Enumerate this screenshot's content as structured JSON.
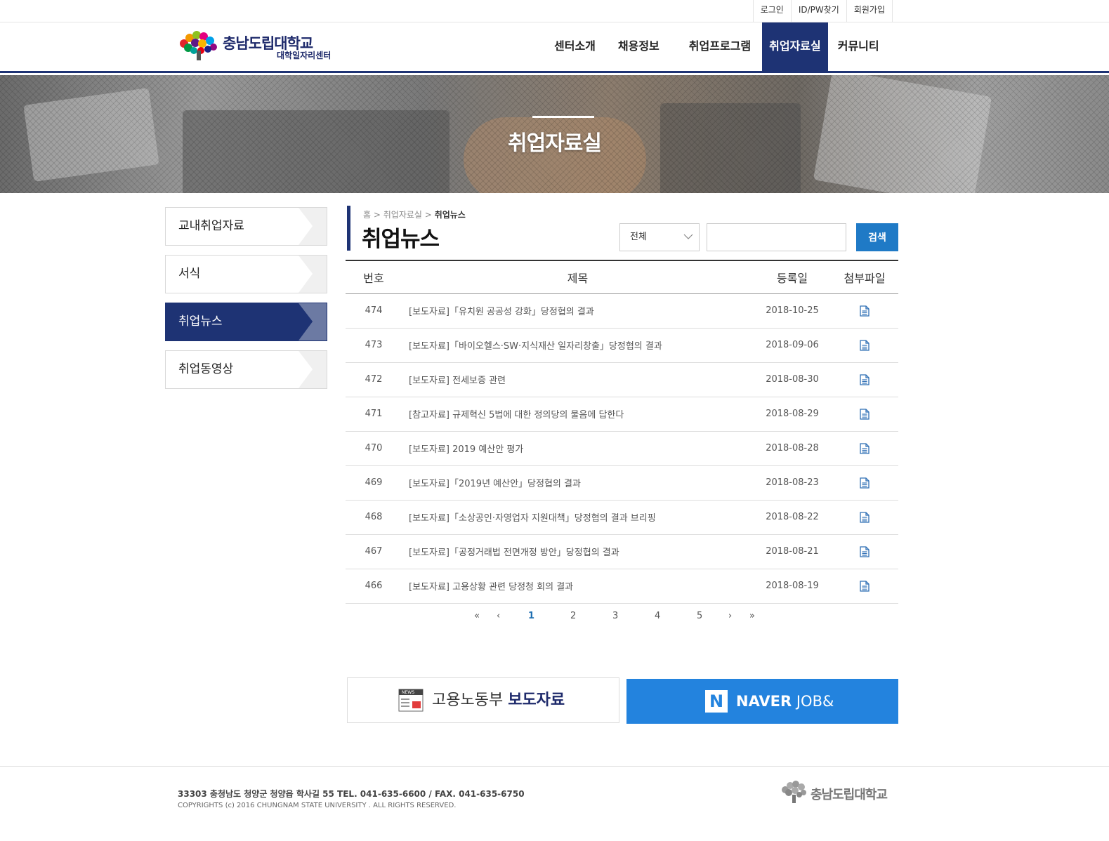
{
  "util_links": [
    "로그인",
    "ID/PW찾기",
    "회원가입"
  ],
  "logo": {
    "title": "충남도립대학교",
    "subtitle": "대학일자리센터"
  },
  "gnb": [
    {
      "label": "센터소개",
      "active": false
    },
    {
      "label": "채용정보",
      "active": false
    },
    {
      "label": "취업프로그램",
      "active": false
    },
    {
      "label": "취업자료실",
      "active": true
    },
    {
      "label": "커뮤니티",
      "active": false
    }
  ],
  "hero": {
    "title": "취업자료실"
  },
  "lnb": [
    {
      "label": "교내취업자료",
      "active": false
    },
    {
      "label": "서식",
      "active": false
    },
    {
      "label": "취업뉴스",
      "active": true
    },
    {
      "label": "취업동영상",
      "active": false
    }
  ],
  "breadcrumb": {
    "home": "홈",
    "sep": ">",
    "parent": "취업자료실",
    "current": "취업뉴스"
  },
  "page_title": "취업뉴스",
  "search": {
    "select_value": "전체",
    "input_value": "",
    "button_label": "검색"
  },
  "board": {
    "headers": {
      "no": "번호",
      "title": "제목",
      "date": "등록일",
      "file": "첨부파일"
    },
    "rows": [
      {
        "no": "474",
        "title": "[보도자료]「유치원 공공성 강화」당정협의 결과",
        "date": "2018-10-25"
      },
      {
        "no": "473",
        "title": "[보도자료]「바이오헬스·SW·지식재산 일자리창출」당정협의 결과",
        "date": "2018-09-06"
      },
      {
        "no": "472",
        "title": "[보도자료] 전세보증 관련",
        "date": "2018-08-30"
      },
      {
        "no": "471",
        "title": "[참고자료] 규제혁신 5법에 대한 정의당의 물음에 답한다",
        "date": "2018-08-29"
      },
      {
        "no": "470",
        "title": "[보도자료] 2019 예산안 평가",
        "date": "2018-08-28"
      },
      {
        "no": "469",
        "title": "[보도자료]「2019년 예산안」당정협의 결과",
        "date": "2018-08-23"
      },
      {
        "no": "468",
        "title": "[보도자료]「소상공인·자영업자 지원대책」당정협의 결과 브리핑",
        "date": "2018-08-22"
      },
      {
        "no": "467",
        "title": "[보도자료]「공정거래법 전면개정 방안」당정협의 결과",
        "date": "2018-08-21"
      },
      {
        "no": "466",
        "title": "[보도자료] 고용상황 관련 당정청 회의 결과",
        "date": "2018-08-19"
      }
    ]
  },
  "paging": {
    "first": "«",
    "prev": "‹",
    "pages": [
      "1",
      "2",
      "3",
      "4",
      "5"
    ],
    "current": "1",
    "next": "›",
    "last": "»"
  },
  "banners": {
    "moel": {
      "badge": "NEWS",
      "prefix": "고용노동부",
      "bold": "보도자료"
    },
    "naver": {
      "badge": "N",
      "bold": "NAVER",
      "suffix": "JOB&"
    }
  },
  "footer": {
    "address": "33303 충청남도 청양군 청양읍 학사길 55 TEL. 041-635-6600 / FAX. 041-635-6750",
    "copyright": "COPYRIGHTS (c) 2016 CHUNGNAM STATE UNIVERSITY . ALL RIGHTS RESERVED.",
    "logo": "충남도립대학교"
  },
  "colors": {
    "navy": "#1e3374",
    "blue": "#1f7ac6",
    "naver_blue": "#2383de"
  }
}
